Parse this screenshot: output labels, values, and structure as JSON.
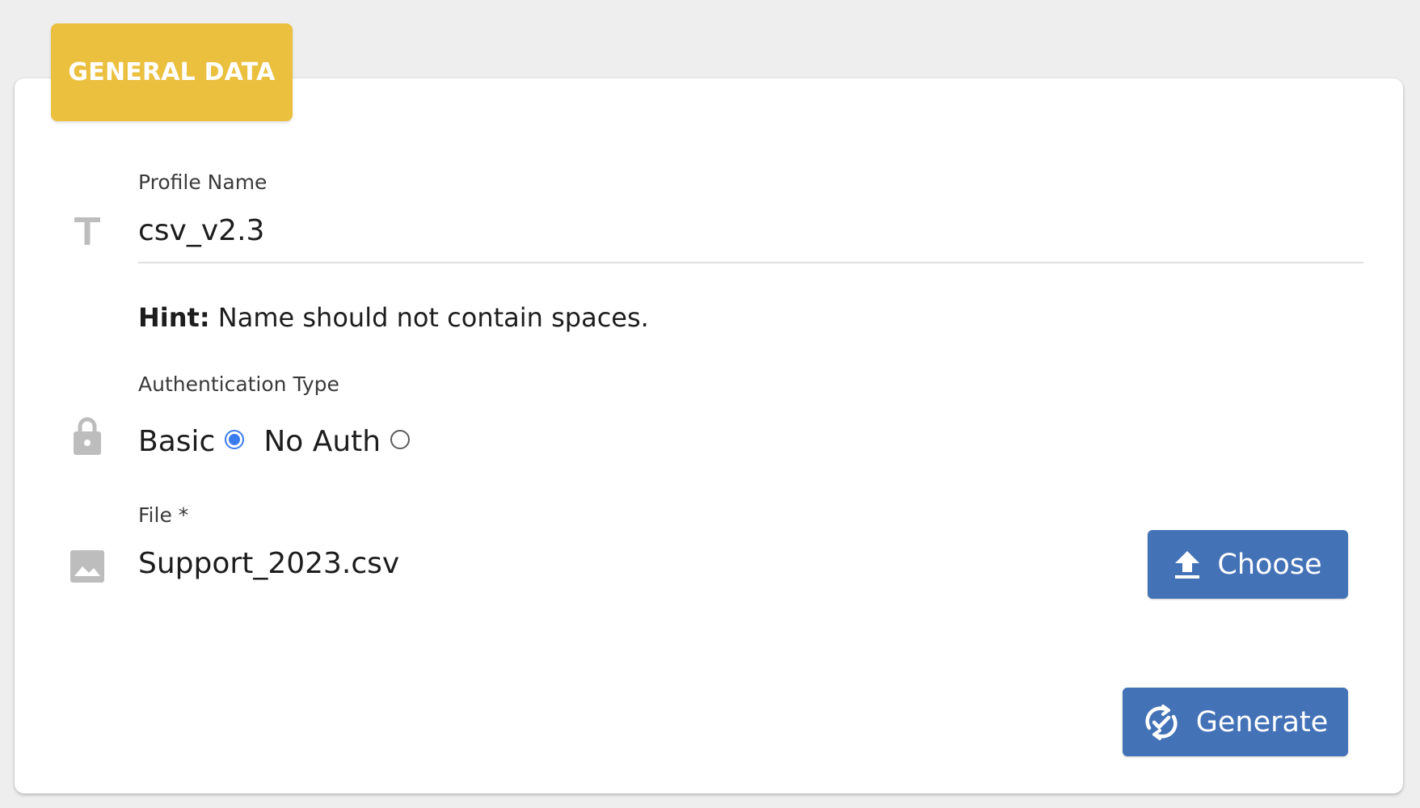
{
  "section": {
    "title": "GENERAL DATA"
  },
  "profile_name": {
    "label": "Profile Name",
    "value": "csv_v2.3",
    "icon": "text-format-icon"
  },
  "hint": {
    "prefix": "Hint:",
    "text": " Name should not contain spaces."
  },
  "authentication": {
    "label": "Authentication Type",
    "icon": "lock-icon",
    "options": [
      {
        "label": "Basic",
        "selected": true
      },
      {
        "label": "No Auth",
        "selected": false
      }
    ]
  },
  "file": {
    "label": "File *",
    "value": "Support_2023.csv",
    "icon": "image-icon"
  },
  "buttons": {
    "choose_label": "Choose",
    "choose_icon": "upload-icon",
    "generate_label": "Generate",
    "generate_icon": "sync-check-icon"
  },
  "colors": {
    "tab_accent": "#ebc03f",
    "button_primary": "#4472b7",
    "radio_selected": "#3a7bf0",
    "icon_gray": "#bdbdbd"
  }
}
